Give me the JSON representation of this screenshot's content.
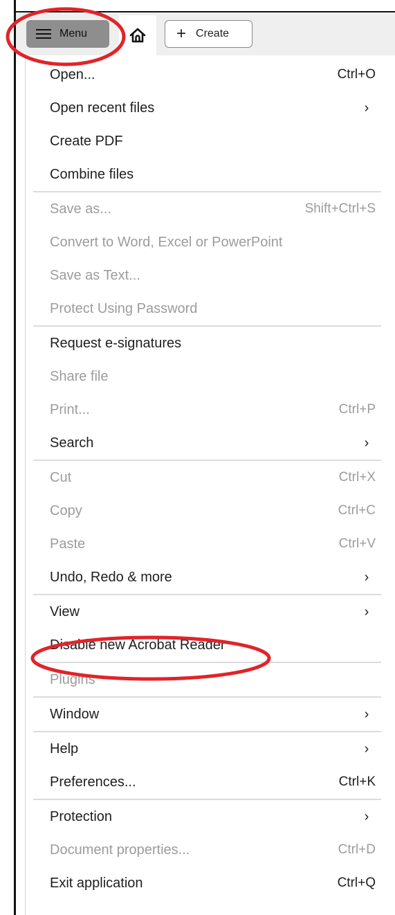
{
  "toolbar": {
    "menu_label": "Menu",
    "create_label": "Create"
  },
  "menu": {
    "open": {
      "label": "Open...",
      "shortcut": "Ctrl+O"
    },
    "open_recent": {
      "label": "Open recent files"
    },
    "create_pdf": {
      "label": "Create PDF"
    },
    "combine_files": {
      "label": "Combine files"
    },
    "save_as": {
      "label": "Save as...",
      "shortcut": "Shift+Ctrl+S"
    },
    "convert": {
      "label": "Convert to Word, Excel or PowerPoint"
    },
    "save_as_text": {
      "label": "Save as Text..."
    },
    "protect_password": {
      "label": "Protect Using Password"
    },
    "request_esign": {
      "label": "Request e-signatures"
    },
    "share_file": {
      "label": "Share file"
    },
    "print": {
      "label": "Print...",
      "shortcut": "Ctrl+P"
    },
    "search": {
      "label": "Search"
    },
    "cut": {
      "label": "Cut",
      "shortcut": "Ctrl+X"
    },
    "copy": {
      "label": "Copy",
      "shortcut": "Ctrl+C"
    },
    "paste": {
      "label": "Paste",
      "shortcut": "Ctrl+V"
    },
    "undo_redo": {
      "label": "Undo, Redo & more"
    },
    "view": {
      "label": "View"
    },
    "disable_new_reader": {
      "label": "Disable new Acrobat Reader"
    },
    "plugins": {
      "label": "Plugins"
    },
    "window": {
      "label": "Window"
    },
    "help": {
      "label": "Help"
    },
    "preferences": {
      "label": "Preferences...",
      "shortcut": "Ctrl+K"
    },
    "protection": {
      "label": "Protection"
    },
    "doc_properties": {
      "label": "Document properties...",
      "shortcut": "Ctrl+D"
    },
    "exit": {
      "label": "Exit application",
      "shortcut": "Ctrl+Q"
    }
  },
  "icons": {
    "menu": "hamburger-icon",
    "home": "home-icon",
    "create": "plus-icon",
    "submenu": "chevron-right-icon"
  },
  "colors": {
    "enabled_text": "#1e1e1e",
    "disabled_text": "#9c9c9c",
    "annotation": "#e0242a"
  }
}
